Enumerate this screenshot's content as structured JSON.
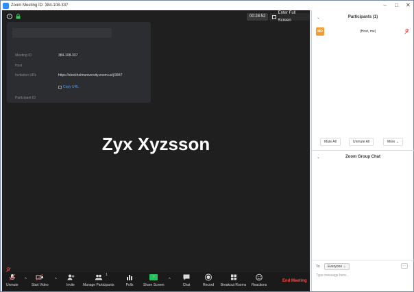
{
  "window": {
    "title": "Zoom Meeting ID: 384-108-337",
    "minimize_glyph": "–",
    "maximize_glyph": "□",
    "close_glyph": "✕"
  },
  "top_bar": {
    "info_glyph": "i",
    "timer": "00:28:52",
    "fullscreen_label": "Enter Full Screen"
  },
  "meeting_info": {
    "meeting_id_label": "Meeting ID",
    "meeting_id_value": "384-108-337",
    "host_label": "Host",
    "invitation_url_label": "Invitation URL",
    "invitation_url_value": "https://stockholmuniversity.zoom.us/j/3847",
    "copy_url_label": "Copy URL",
    "participant_id_label": "Participant ID"
  },
  "main": {
    "participant_name": "Zyx Xyzsson"
  },
  "toolbar": {
    "unmute_label": "Unmute",
    "start_video_label": "Start Video",
    "invite_label": "Invite",
    "manage_participants_label": "Manage Participants",
    "participant_count": "1",
    "polls_label": "Polls",
    "share_screen_label": "Share Screen",
    "chat_label": "Chat",
    "record_label": "Record",
    "breakout_rooms_label": "Breakout Rooms",
    "reactions_label": "Reactions",
    "end_meeting_label": "End Meeting",
    "caret_glyph": "^",
    "share_glyph": "↑"
  },
  "participants_panel": {
    "header": "Participants (1)",
    "collapse_glyph": "⌄",
    "participants": [
      {
        "initials": "MD",
        "name": "(Host, me)"
      }
    ],
    "mute_all_label": "Mute All",
    "unmute_all_label": "Unmute All",
    "more_label": "More ⌄"
  },
  "chat_panel": {
    "header": "Zoom Group Chat",
    "collapse_glyph": "⌄",
    "to_label": "To:",
    "recipient": "Everyone ⌄",
    "more_glyph": "...",
    "input_placeholder": "Type message here..."
  },
  "colors": {
    "video_bg": "#1f1f1f",
    "toolbar_bg": "#1a1a1a",
    "end_meeting": "#ff4a4a",
    "share_green": "#23c45e",
    "avatar_orange": "#f59a2c",
    "link_blue": "#4aa3ff"
  },
  "icons": {
    "info": "info-icon",
    "lock": "lock-icon",
    "mic_muted": "mic-muted-icon",
    "video_off": "video-off-icon",
    "invite": "person-add-icon",
    "participants": "people-icon",
    "polls": "bar-chart-icon",
    "share": "share-screen-icon",
    "chat": "chat-bubble-icon",
    "record": "record-icon",
    "breakout": "grid-icon",
    "reactions": "emoji-icon"
  }
}
